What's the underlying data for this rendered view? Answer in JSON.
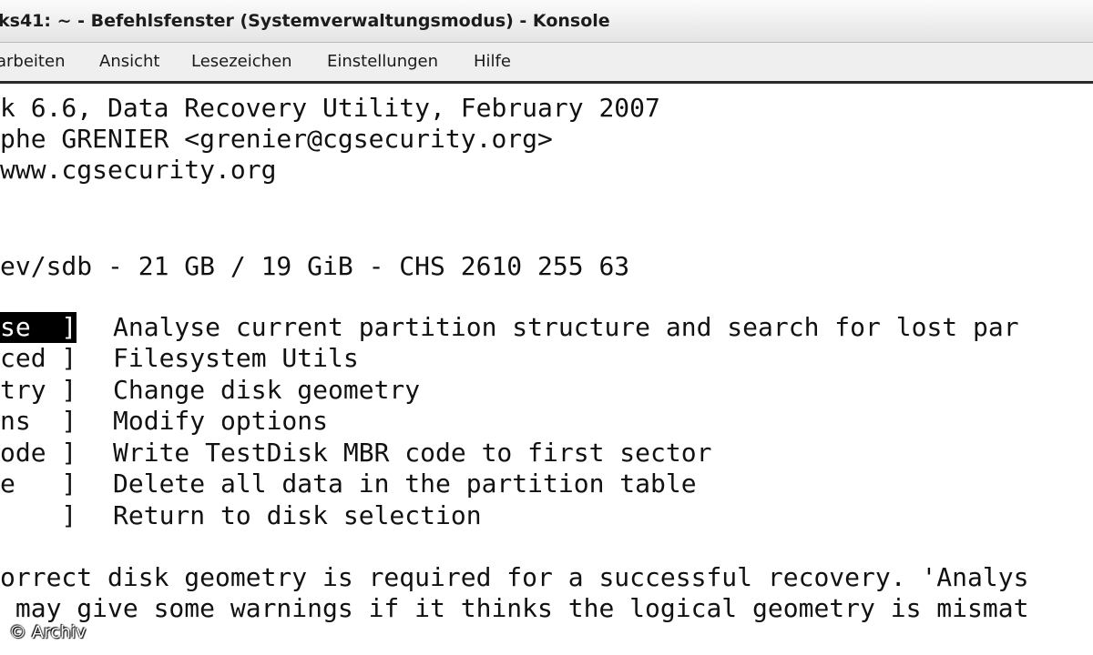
{
  "window": {
    "title": "ks41: ~ - Befehlsfenster (Systemverwaltungsmodus) - Konsole"
  },
  "menu": {
    "items": [
      "arbeiten",
      "Ansicht",
      "Lesezeichen",
      "Einstellungen",
      "Hilfe"
    ]
  },
  "terminal": {
    "header": [
      "k 6.6, Data Recovery Utility, February 2007",
      "phe GRENIER <grenier@cgsecurity.org>",
      "www.cgsecurity.org"
    ],
    "disk": "ev/sdb - 21 GB / 19 GiB - CHS 2610 255 63",
    "options": [
      {
        "label": "se  ]",
        "description": "Analyse current partition structure and search for lost par",
        "selected": true
      },
      {
        "label": "ced ]",
        "description": "Filesystem Utils",
        "selected": false
      },
      {
        "label": "try ]",
        "description": "Change disk geometry",
        "selected": false
      },
      {
        "label": "ns  ]",
        "description": "Modify options",
        "selected": false
      },
      {
        "label": "ode ]",
        "description": "Write TestDisk MBR code to first sector",
        "selected": false
      },
      {
        "label": "e   ]",
        "description": "Delete all data in the partition table",
        "selected": false
      },
      {
        "label": "    ]",
        "description": "Return to disk selection",
        "selected": false
      }
    ],
    "footer": [
      "orrect disk geometry is required for a successful recovery. 'Analys",
      " may give some warnings if it thinks the logical geometry is mismat"
    ]
  },
  "watermark": "© Archiv"
}
